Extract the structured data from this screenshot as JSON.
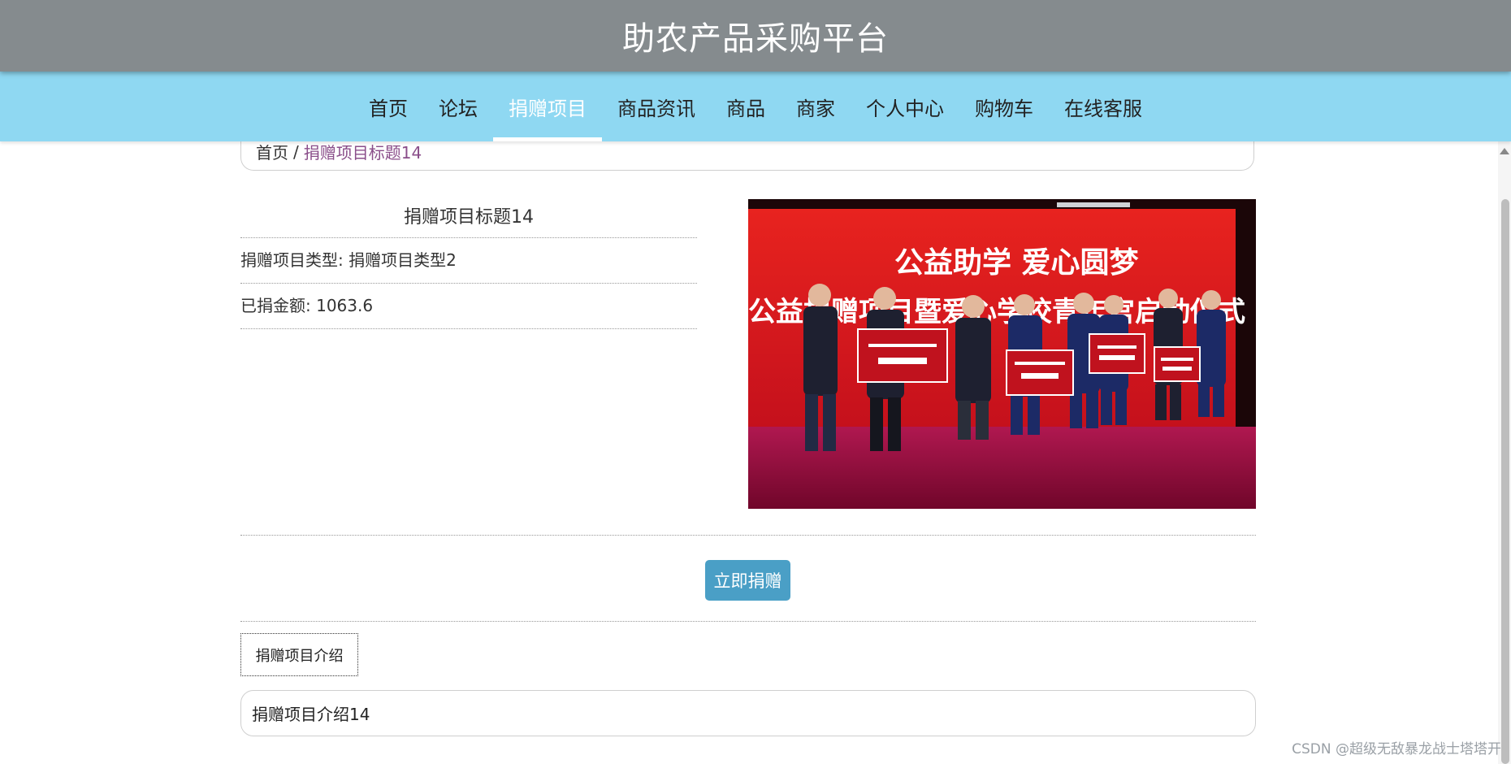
{
  "header": {
    "title": "助农产品采购平台"
  },
  "nav": {
    "items": [
      {
        "label": "首页"
      },
      {
        "label": "论坛"
      },
      {
        "label": "捐赠项目"
      },
      {
        "label": "商品资讯"
      },
      {
        "label": "商品"
      },
      {
        "label": "商家"
      },
      {
        "label": "个人中心"
      },
      {
        "label": "购物车"
      },
      {
        "label": "在线客服"
      }
    ],
    "active_index": 2
  },
  "breadcrumb": {
    "home": "首页",
    "separator": "/",
    "current": "捐赠项目标题14"
  },
  "project": {
    "title": "捐赠项目标题14",
    "type_label": "捐赠项目类型:",
    "type_value": "捐赠项目类型2",
    "amount_label": "已捐金额:",
    "amount_value": "1063.6"
  },
  "photo": {
    "banner_line1": "公益助学 爱心圆梦",
    "banner_line2": "公益捐赠项目暨爱心学校青年宫启动仪式"
  },
  "actions": {
    "donate_label": "立即捐赠"
  },
  "intro": {
    "tab_label": "捐赠项目介绍",
    "content": "捐赠项目介绍14"
  },
  "watermark": "CSDN @超级无敌暴龙战士塔塔开",
  "colors": {
    "header_bg": "#858b8e",
    "nav_bg": "#8fd8f2",
    "button_bg": "#4a9fc6",
    "breadcrumb_current": "#8a4e8a"
  }
}
